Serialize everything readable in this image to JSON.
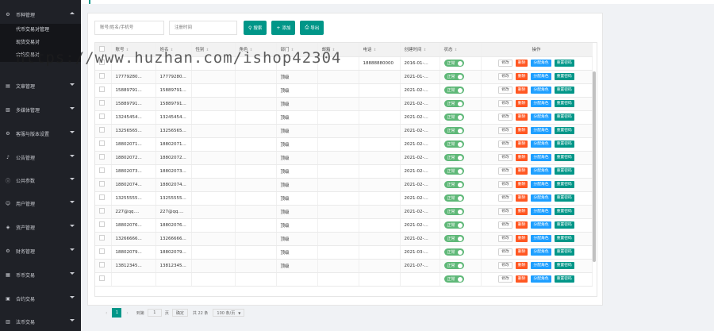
{
  "topbar": {
    "crumb": "代币管理"
  },
  "sidebar": {
    "items": [
      {
        "label": "币种管理",
        "icon": "gear-icon",
        "open": true
      },
      {
        "label": "文章管理",
        "icon": "doc-icon"
      },
      {
        "label": "多媒体管理",
        "icon": "media-icon"
      },
      {
        "label": "客服与版本设置",
        "icon": "settings-icon"
      },
      {
        "label": "公告管理",
        "icon": "bell-icon"
      },
      {
        "label": "公共参数",
        "icon": "info-icon"
      },
      {
        "label": "用户管理",
        "icon": "user-icon"
      },
      {
        "label": "资产管理",
        "icon": "asset-icon"
      },
      {
        "label": "财务管理",
        "icon": "finance-icon"
      },
      {
        "label": "币币交易",
        "icon": "exchange-icon"
      },
      {
        "label": "合约交易",
        "icon": "contract-icon"
      },
      {
        "label": "法币交易",
        "icon": "fiat-icon"
      }
    ],
    "submenu": [
      "代币交易对管理",
      "现货交易对",
      "合约交易对"
    ]
  },
  "toolbar": {
    "search_placeholder": "账号/姓名/手机号",
    "date_placeholder": "注册时间",
    "search_label": "搜索",
    "add_label": "添加",
    "export_label": "导出"
  },
  "table": {
    "headers": [
      "账号",
      "姓名",
      "性别",
      "角色",
      "部门",
      "邮箱",
      "电话",
      "创建时间",
      "状态",
      "操作"
    ],
    "status_label": "正常",
    "ops": {
      "edit": "修改",
      "del": "删除",
      "role": "分配角色",
      "reset": "重置密码"
    },
    "rows": [
      [
        "",
        "",
        "",
        "",
        "",
        "",
        "18888880000",
        "2016-01-..."
      ],
      [
        "17779280...",
        "17779280...",
        "",
        "",
        "顶级",
        "",
        "",
        "2021-01-..."
      ],
      [
        "15889791...",
        "15889791...",
        "",
        "",
        "顶级",
        "",
        "",
        "2021-02-..."
      ],
      [
        "15889791...",
        "15889791...",
        "",
        "",
        "顶级",
        "",
        "",
        "2021-02-..."
      ],
      [
        "13245454...",
        "13245454...",
        "",
        "",
        "顶级",
        "",
        "",
        "2021-02-..."
      ],
      [
        "13256565...",
        "13256565...",
        "",
        "",
        "顶级",
        "",
        "",
        "2021-02-..."
      ],
      [
        "18802071...",
        "18802071...",
        "",
        "",
        "顶级",
        "",
        "",
        "2021-02-..."
      ],
      [
        "18802072...",
        "18802072...",
        "",
        "",
        "顶级",
        "",
        "",
        "2021-02-..."
      ],
      [
        "18802073...",
        "18802073...",
        "",
        "",
        "顶级",
        "",
        "",
        "2021-02-..."
      ],
      [
        "18802074...",
        "18802074...",
        "",
        "",
        "顶级",
        "",
        "",
        "2021-02-..."
      ],
      [
        "13255555...",
        "13255555...",
        "",
        "",
        "顶级",
        "",
        "",
        "2021-02-..."
      ],
      [
        "227@qq....",
        "227@qq....",
        "",
        "",
        "顶级",
        "",
        "",
        "2021-02-..."
      ],
      [
        "18802076...",
        "18802076...",
        "",
        "",
        "顶级",
        "",
        "",
        "2021-02-..."
      ],
      [
        "13266666...",
        "13266666...",
        "",
        "",
        "顶级",
        "",
        "",
        "2021-02-..."
      ],
      [
        "18802079...",
        "18802079...",
        "",
        "",
        "顶级",
        "",
        "",
        "2021-03-..."
      ],
      [
        "13812345...",
        "13812345...",
        "",
        "",
        "顶级",
        "",
        "",
        "2021-07-..."
      ],
      [
        "",
        "",
        "",
        "",
        "",
        "",
        "",
        ""
      ]
    ]
  },
  "pager": {
    "current": "1",
    "goto_label": "到第",
    "page_input": "1",
    "page_unit": "页",
    "confirm_label": "确定",
    "total_label": "共 22 条",
    "size_label": "100 条/页"
  },
  "watermark": "https://www.huzhan.com/ishop42304"
}
